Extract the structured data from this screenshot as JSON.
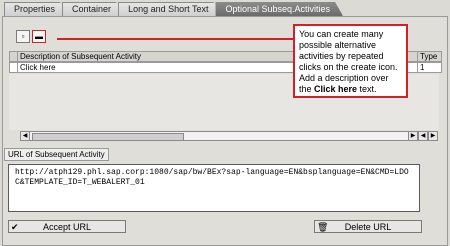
{
  "tabs": [
    "Properties",
    "Container",
    "Long and Short Text",
    "Optional Subseq.Activities"
  ],
  "toolbar": {
    "create_icon": "create-icon",
    "delete_icon": "delete-icon"
  },
  "table": {
    "headers": [
      "Description of Subsequent Activity",
      "Type"
    ],
    "rows": [
      {
        "description": "Click here",
        "type": "1"
      }
    ]
  },
  "callout": {
    "text_before": "You can create many possible alternative activities by repeated clicks on the create icon. Add a description over the ",
    "bold": "Click here",
    "text_after": " text."
  },
  "url_section": {
    "label": "URL of Subsequent Activity",
    "value": "http://atph129.phl.sap.corp:1080/sap/bw/BEx?sap-language=EN&bsplanguage=EN&CMD=LDOC&TEMPLATE_ID=T_WEBALERT_01"
  },
  "buttons": {
    "accept": "Accept URL",
    "delete": "Delete URL"
  },
  "colors": {
    "accent": "#d0202a"
  }
}
